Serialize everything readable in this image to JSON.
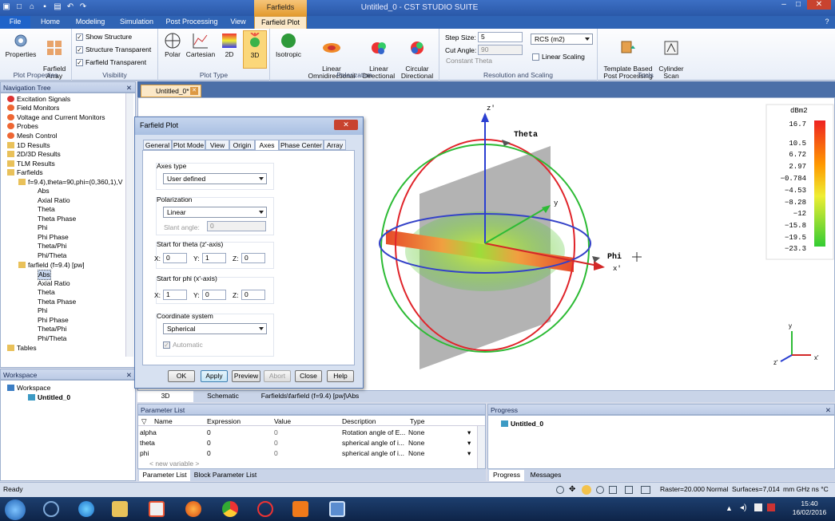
{
  "titlebar": {
    "context_tab": "Farfields",
    "title": "Untitled_0 - CST STUDIO SUITE",
    "min": "–",
    "max": "□",
    "close": "✕",
    "help": "?"
  },
  "menu_tabs": [
    "File",
    "Home",
    "Modeling",
    "Simulation",
    "Post Processing",
    "View",
    "Farfield Plot"
  ],
  "ribbon": {
    "plot_properties": {
      "label": "Plot Properties",
      "properties": "Properties",
      "farfield_array": "Farfield\nArray"
    },
    "visibility": {
      "label": "Visibility",
      "show_structure": "Show Structure",
      "structure_transparent": "Structure Transparent",
      "farfield_transparent": "Farfield Transparent"
    },
    "plot_type": {
      "label": "Plot Type",
      "polar": "Polar",
      "cartesian": "Cartesian",
      "twod": "2D",
      "threed": "3D"
    },
    "polarization": {
      "label": "Polarization",
      "isotropic": "Isotropic",
      "linear_omni": "Linear\nOmnidirectional",
      "linear_dir": "Linear\nDirectional",
      "circular_dir": "Circular\nDirectional"
    },
    "resolution": {
      "label": "Resolution and Scaling",
      "step_size_label": "Step Size:",
      "step_size": "5",
      "cut_angle_label": "Cut Angle:",
      "cut_angle": "90",
      "constant_theta": "Constant Theta",
      "rcs": "RCS (m2)",
      "linear_scaling": "Linear Scaling"
    },
    "tools": {
      "label": "Tools",
      "template": "Template Based\nPost Processing",
      "cylinder": "Cylinder\nScan"
    }
  },
  "nav_tree": {
    "title": "Navigation Tree",
    "items": [
      "Excitation Signals",
      "Field Monitors",
      "Voltage and Current Monitors",
      "Probes",
      "Mesh Control",
      "1D Results",
      "2D/3D Results",
      "TLM Results",
      "Farfields",
      "f=9.4),theta=90,phi=(0,360,1),V",
      "Abs",
      "Axial Ratio",
      "Theta",
      "Theta Phase",
      "Phi",
      "Phi Phase",
      "Theta/Phi",
      "Phi/Theta",
      "farfield (f=9.4) [pw]",
      "Abs",
      "Axial Ratio",
      "Theta",
      "Theta Phase",
      "Phi",
      "Phi Phase",
      "Theta/Phi",
      "Phi/Theta",
      "Tables"
    ]
  },
  "workspace": {
    "title": "Workspace",
    "root": "Workspace",
    "child": "Untitled_0"
  },
  "doc_tab": "Untitled_0*",
  "dialog": {
    "title": "Farfield Plot",
    "tabs": [
      "General",
      "Plot Mode",
      "View",
      "Origin",
      "Axes",
      "Phase Center",
      "Array"
    ],
    "axes_type_label": "Axes type",
    "axes_type": "User defined",
    "polarization_label": "Polarization",
    "polarization": "Linear",
    "slant_label": "Slant angle:",
    "slant": "0",
    "theta_label": "Start for theta (z'-axis)",
    "theta_x": "0",
    "theta_y": "1",
    "theta_z": "0",
    "phi_label": "Start for phi (x'-axis)",
    "phi_x": "1",
    "phi_y": "0",
    "phi_z": "0",
    "coord_label": "Coordinate system",
    "coord": "Spherical",
    "automatic": "Automatic",
    "x": "X:",
    "y": "Y:",
    "z": "Z:",
    "buttons": {
      "ok": "OK",
      "apply": "Apply",
      "preview": "Preview",
      "abort": "Abort",
      "close": "Close",
      "help": "Help"
    }
  },
  "viewport": {
    "axis_z": "z'",
    "axis_y": "y",
    "axis_x": "x'",
    "theta": "Theta",
    "phi": "Phi"
  },
  "legend": {
    "unit": "dBm2",
    "values": [
      "16.7",
      "10.5",
      "6.72",
      "2.97",
      "−0.784",
      "−4.53",
      "−8.28",
      "−12",
      "−15.8",
      "−19.5",
      "−23.3"
    ]
  },
  "view_tabs": [
    "3D",
    "Schematic",
    "Farfields\\farfield (f=9.4) [pw]\\Abs"
  ],
  "param_list": {
    "title": "Parameter List",
    "columns": [
      "Name",
      "Expression",
      "Value",
      "Description",
      "Type"
    ],
    "rows": [
      {
        "name": "alpha",
        "expr": "0",
        "value": "0",
        "desc": "Rotation angle of E...",
        "type": "None"
      },
      {
        "name": "theta",
        "expr": "0",
        "value": "0",
        "desc": "spherical angle of i...",
        "type": "None"
      },
      {
        "name": "phi",
        "expr": "0",
        "value": "0",
        "desc": "spherical angle of i...",
        "type": "None"
      }
    ],
    "new_row": "< new variable >",
    "tabs": [
      "Parameter List",
      "Block Parameter List"
    ]
  },
  "progress": {
    "title": "Progress",
    "item": "Untitled_0",
    "tabs": [
      "Progress",
      "Messages"
    ]
  },
  "status": {
    "ready": "Ready",
    "raster": "Raster=20.000",
    "mode": "Normal",
    "surfaces": "Surfaces=7,014",
    "units": "mm  GHz  ns  °C"
  },
  "clock": {
    "time": "15:40",
    "date": "16/02/2016"
  },
  "colors": {
    "accent": "#2a58a8",
    "selected_tab": "#fbe8c8"
  }
}
